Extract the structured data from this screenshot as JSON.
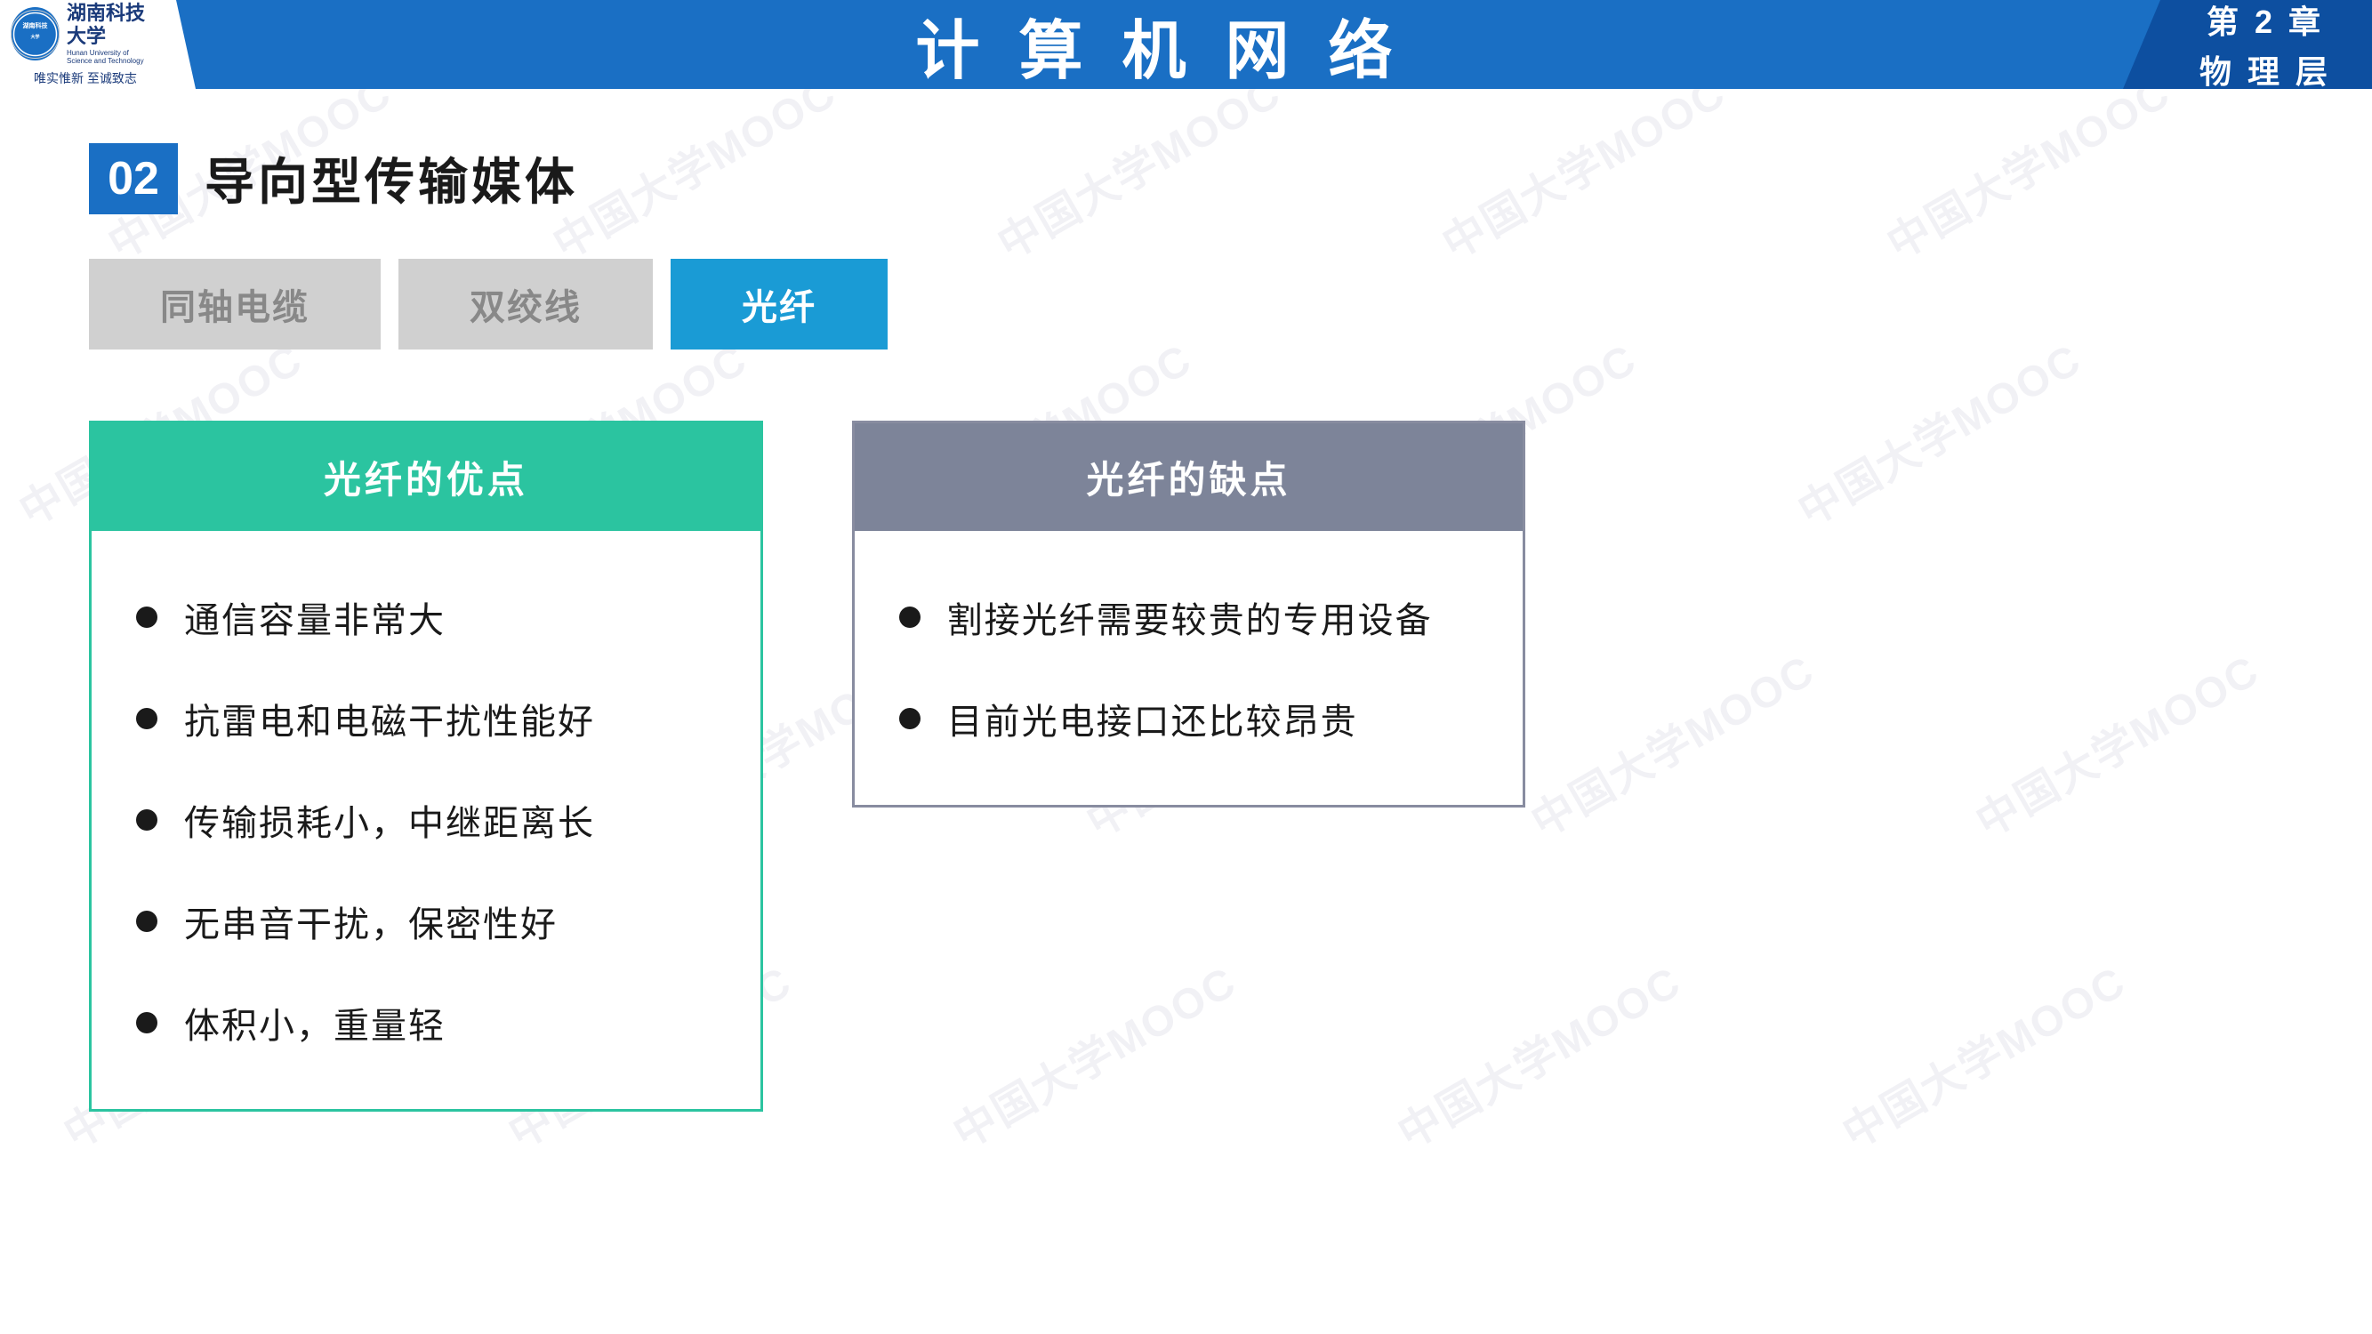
{
  "header": {
    "logo_cn": "湖南科技大学",
    "logo_en": "Hunan University of Science and Technology",
    "motto": "唯实惟新   至诚致志",
    "title": "计 算 机 网 络",
    "chapter_title": "第 2 章",
    "chapter_sub": "物 理 层"
  },
  "section": {
    "number": "02",
    "title": "导向型传输媒体"
  },
  "tabs": [
    {
      "label": "同轴电缆",
      "active": false
    },
    {
      "label": "双绞线",
      "active": false
    },
    {
      "label": "光纤",
      "active": true
    }
  ],
  "pros_card": {
    "title": "光纤的优点",
    "items": [
      "通信容量非常大",
      "抗雷电和电磁干扰性能好",
      "传输损耗小，中继距离长",
      "无串音干扰，保密性好",
      "体积小，重量轻"
    ]
  },
  "cons_card": {
    "title": "光纤的缺点",
    "items": [
      "割接光纤需要较贵的专用设备",
      "目前光电接口还比较昂贵"
    ]
  },
  "watermarks": [
    "中国大学MOOC",
    "中国大学MOOC",
    "中国大学MOOC",
    "中国大学MOOC",
    "中国大学MOOC",
    "中国大学MOOC",
    "中国大学MOOC",
    "中国大学MOOC",
    "中国大学MOOC",
    "中国大学MOOC",
    "中国大学MOOC",
    "中国大学MOOC"
  ],
  "colors": {
    "header_blue": "#1a6fc4",
    "tab_active": "#1a9bd5",
    "tab_inactive": "#d0d0d0",
    "pros_green": "#2bc4a0",
    "cons_gray": "#7d8499"
  }
}
